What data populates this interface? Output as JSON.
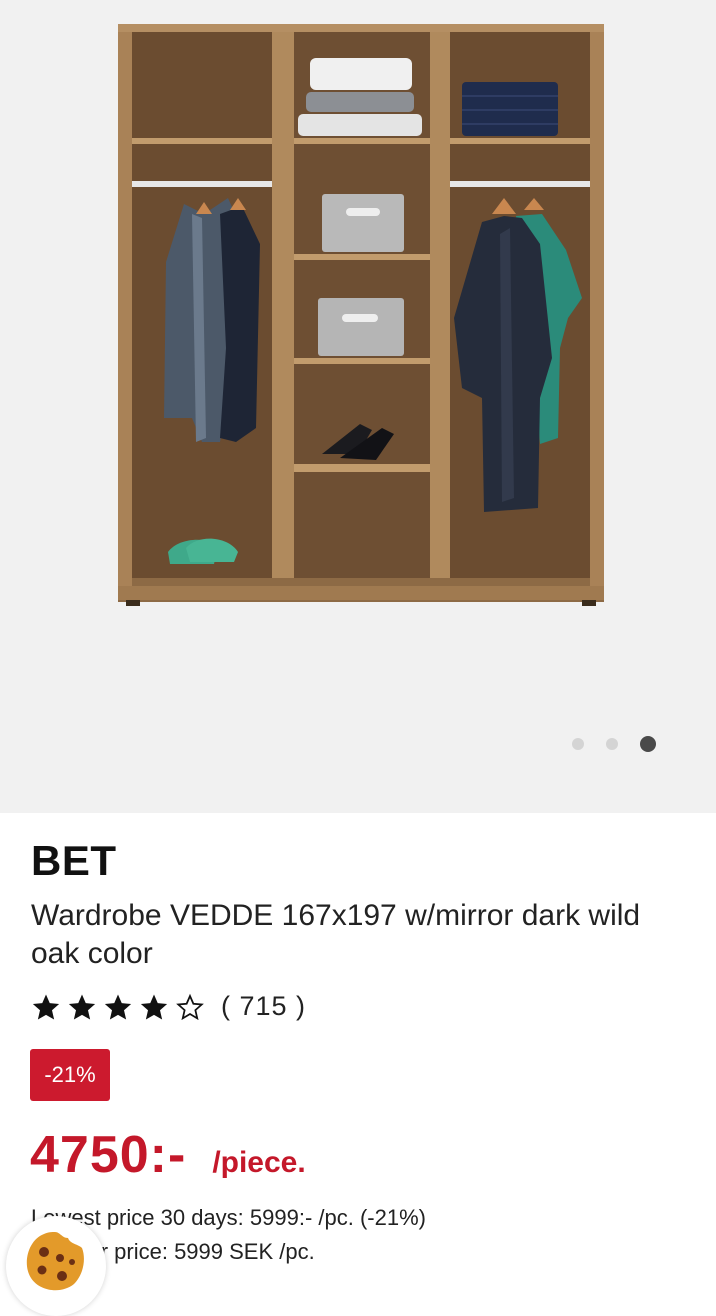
{
  "gallery": {
    "image_alt": "Wardrobe VEDDE",
    "slides": 3,
    "active_slide": 3
  },
  "product": {
    "brand": "BET",
    "title": "Wardrobe VEDDE 167x197 w/mirror dark wild oak color",
    "rating": 4,
    "rating_max": 5,
    "review_count": "( 715 )",
    "discount_badge": "-21%",
    "price": "4750:-",
    "unit": "/piece.",
    "lowest_price": "Lowest price 30 days: 5999:- /pc. (-21%)",
    "regular_price": "Regular price: 5999 SEK /pc."
  },
  "colors": {
    "accent_red": "#c4182a",
    "badge_red": "#cc1a2e",
    "gallery_bg": "#f1f1f1"
  },
  "icons": {
    "star_filled": "star-filled-icon",
    "star_empty": "star-outline-icon",
    "cookie": "cookie-icon"
  }
}
